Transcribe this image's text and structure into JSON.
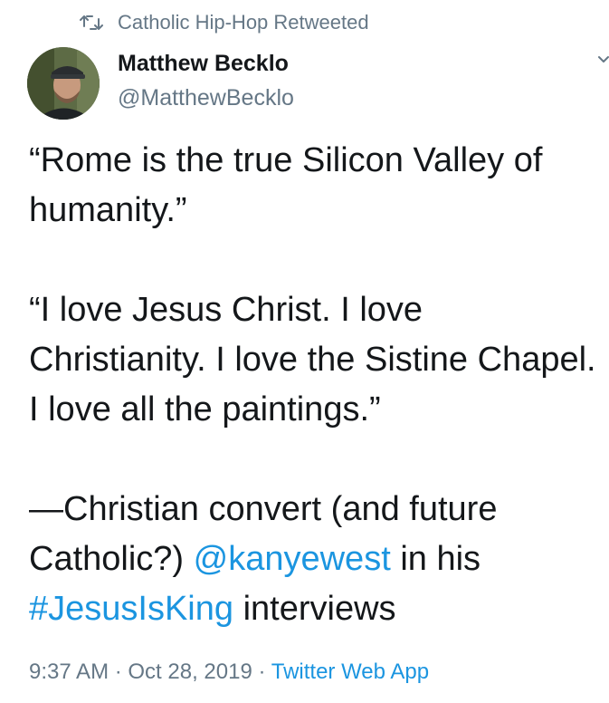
{
  "retweet": {
    "icon": "retweet-icon",
    "text": "Catholic Hip-Hop Retweeted"
  },
  "author": {
    "name": "Matthew Becklo",
    "handle": "@MatthewBecklo",
    "avatar_icon": "avatar"
  },
  "tweet": {
    "p1": "“Rome is the true Silicon Valley of humanity.”",
    "p2": "“I love Jesus Christ. I love Christianity. I love the Sistine Chapel. I love all the paintings.”",
    "p3_prefix": "—Christian convert (and future Catholic?) ",
    "mention": "@kanyewest",
    "p3_middle": " in his ",
    "hashtag": "#JesusIsKing",
    "p3_suffix": " interviews"
  },
  "meta": {
    "time": "9:37 AM",
    "separator1": " · ",
    "date": "Oct 28, 2019",
    "separator2": " · ",
    "source": "Twitter Web App"
  },
  "colors": {
    "text": "#14171a",
    "secondary": "#657786",
    "link": "#1b95e0"
  }
}
